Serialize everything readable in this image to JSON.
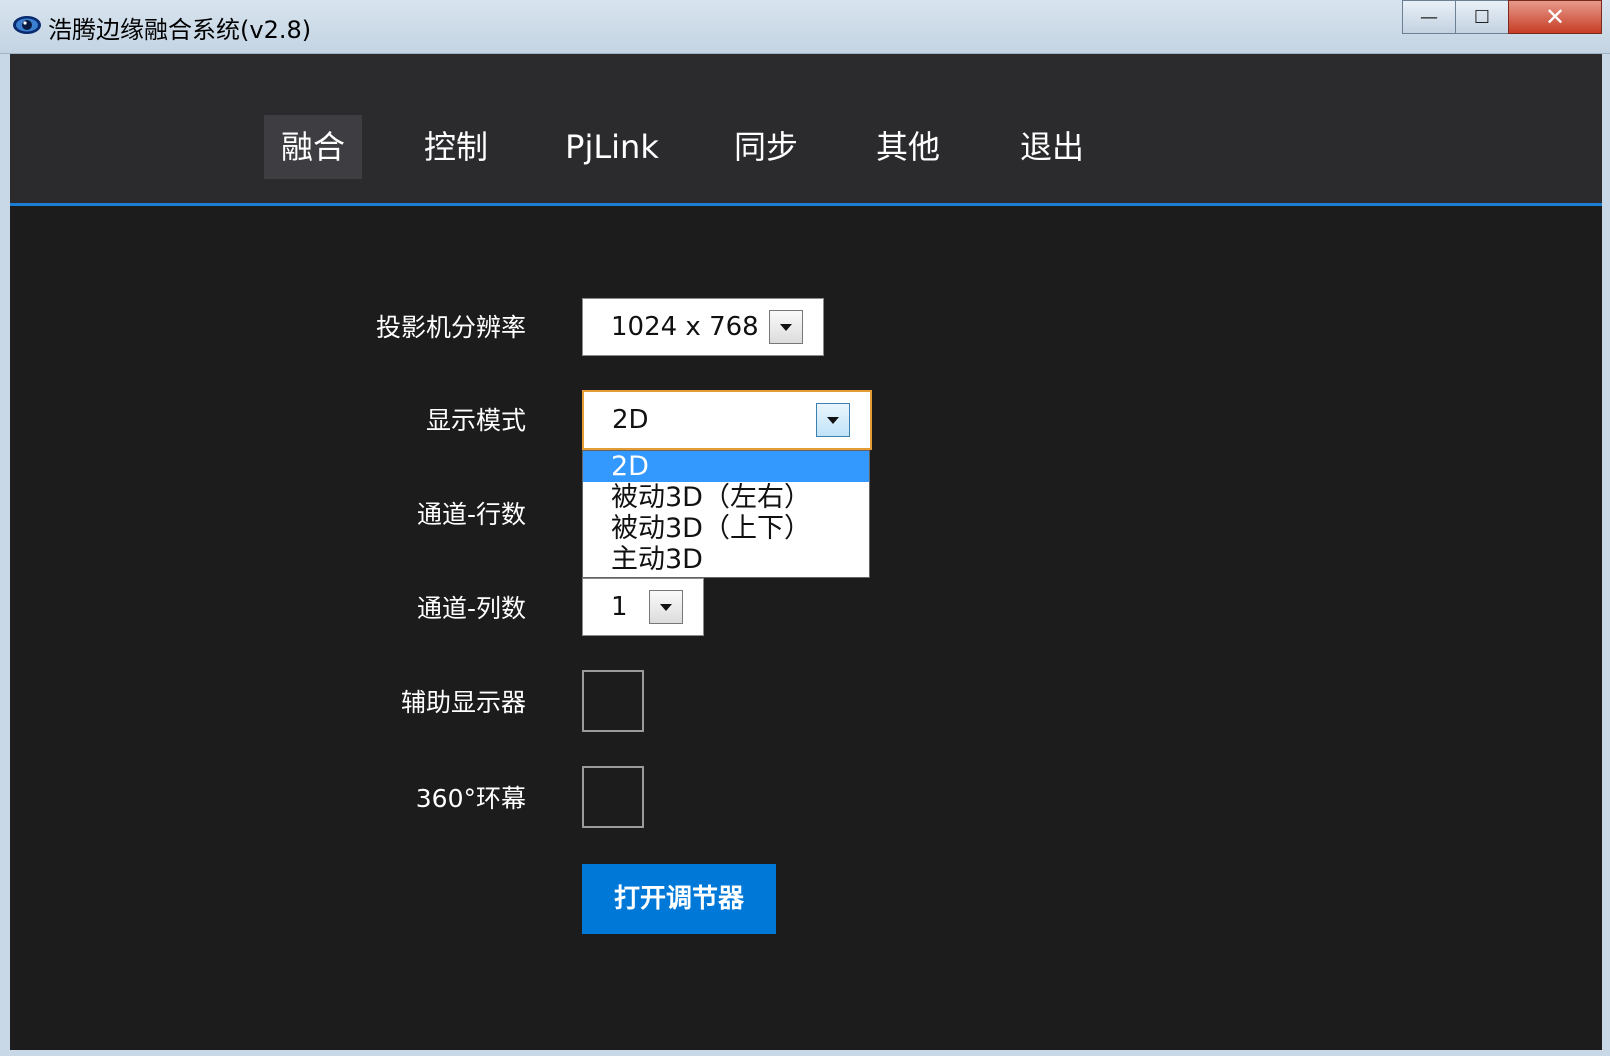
{
  "window": {
    "title": "浩腾边缘融合系统(v2.8)",
    "minimize_label": "—",
    "maximize_label": "☐",
    "close_label": "✕"
  },
  "nav": {
    "tabs": [
      {
        "label": "融合",
        "active": true
      },
      {
        "label": "控制"
      },
      {
        "label": "PjLink"
      },
      {
        "label": "同步"
      },
      {
        "label": "其他"
      },
      {
        "label": "退出"
      }
    ]
  },
  "form": {
    "resolution": {
      "label": "投影机分辨率",
      "value": "1024 x 768"
    },
    "display_mode": {
      "label": "显示模式",
      "value": "2D",
      "options": [
        "2D",
        "被动3D（左右）",
        "被动3D（上下）",
        "主动3D"
      ],
      "selected_index": 0
    },
    "rows": {
      "label": "通道-行数"
    },
    "cols": {
      "label": "通道-列数",
      "value": "1"
    },
    "aux_display": {
      "label": "辅助显示器",
      "checked": false
    },
    "ring_360": {
      "label": "360°环幕",
      "checked": false
    },
    "open_adjuster": {
      "label": "打开调节器"
    }
  },
  "colors": {
    "nav_bg": "#2b2b2e",
    "body_bg": "#1c1c1d",
    "accent": "#1a7fd4",
    "button": "#0078d7",
    "selection": "#3399ff",
    "focus": "#e39b36"
  }
}
